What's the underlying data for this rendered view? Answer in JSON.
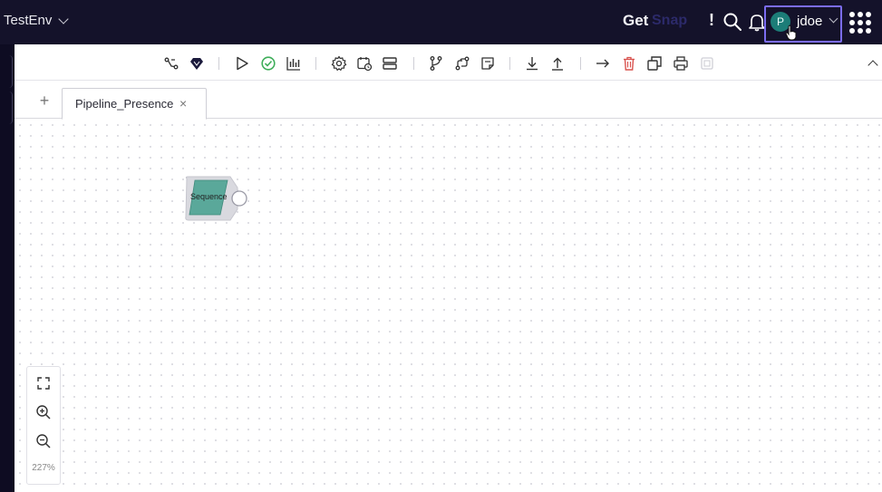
{
  "topbar": {
    "environment": "TestEnv",
    "get_label": "Get",
    "snap_label": "Snap",
    "alert_label": "!",
    "user": {
      "avatar_initial": "P",
      "username": "jdoe"
    }
  },
  "toolbar": {
    "icons": [
      "connect-icon",
      "gem-icon",
      "play-icon",
      "check-circle-icon",
      "chart-icon",
      "gear-icon",
      "schedule-icon",
      "layers-icon",
      "branch-icon",
      "path-icon",
      "note-icon",
      "download-icon",
      "upload-icon",
      "arrow-right-icon",
      "trash-icon",
      "copy-icon",
      "print-icon",
      "export-icon"
    ]
  },
  "tabs": [
    {
      "label": "Pipeline_Presence",
      "close": "×"
    }
  ],
  "tab_add": "+",
  "canvas": {
    "snap": {
      "label": "Sequence"
    },
    "zoom_level": "227%"
  },
  "colors": {
    "topbar_bg": "#14122a",
    "accent_outline": "#7b6cf0",
    "avatar": "#1c7d78",
    "snap_fill": "#5aa89a",
    "delete_red": "#d9534f"
  }
}
